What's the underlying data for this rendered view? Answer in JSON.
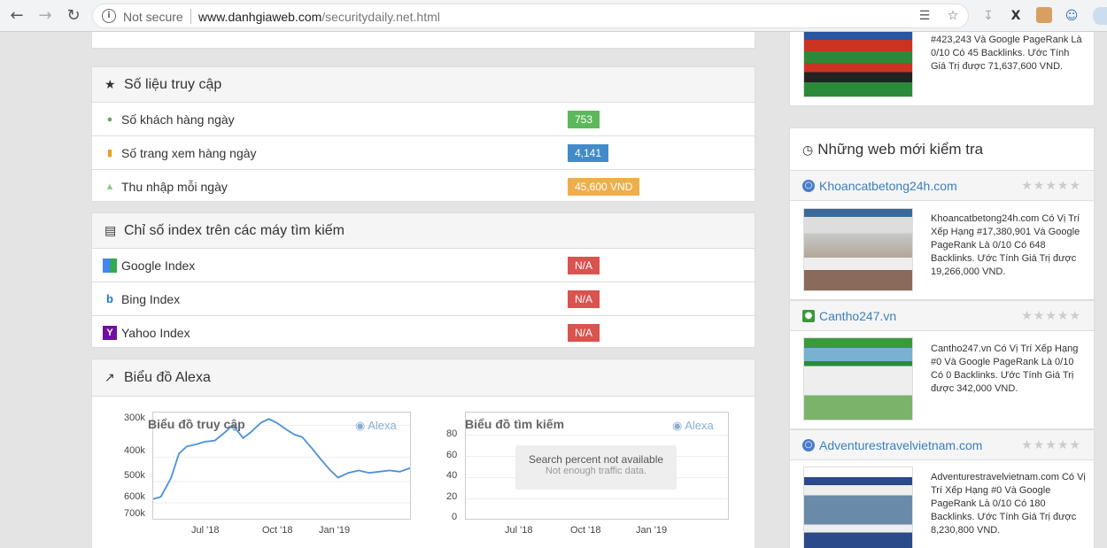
{
  "browser": {
    "security_label": "Not secure",
    "url_host": "www.danhgiaweb.com",
    "url_path": "/securitydaily.net.html"
  },
  "stats": {
    "title": "Số liệu truy cập",
    "rows": [
      {
        "label": "Số khách hàng ngày",
        "value": "753",
        "color": "#5cb85c"
      },
      {
        "label": "Số trang xem hàng ngày",
        "value": "4,141",
        "color": "#428bca"
      },
      {
        "label": "Thu nhập mỗi ngày",
        "value": "45,600 VND",
        "color": "#f0ad4e"
      }
    ]
  },
  "index": {
    "title": "Chỉ số index trên các máy tìm kiếm",
    "rows": [
      {
        "label": "Google Index",
        "value": "N/A"
      },
      {
        "label": "Bing Index",
        "value": "N/A"
      },
      {
        "label": "Yahoo Index",
        "value": "N/A"
      }
    ],
    "na_color": "#d9534f"
  },
  "alexa": {
    "title": "Biểu đồ Alexa",
    "brand": "Alexa",
    "search_msg": "Search percent not available",
    "search_sub": "Not enough traffic data."
  },
  "chart_data": [
    {
      "type": "line",
      "title": "Biểu đồ truy cập",
      "y_ticks": [
        "300k",
        "400k",
        "500k",
        "600k",
        "700k"
      ],
      "x_ticks": [
        "Jul '18",
        "Oct '18",
        "Jan '19"
      ],
      "y_inverted": true,
      "ylim": [
        300000,
        700000
      ],
      "x": [
        0,
        0.03,
        0.07,
        0.1,
        0.13,
        0.17,
        0.2,
        0.24,
        0.28,
        0.31,
        0.35,
        0.38,
        0.42,
        0.45,
        0.48,
        0.52,
        0.55,
        0.58,
        0.62,
        0.65,
        0.69,
        0.72,
        0.76,
        0.8,
        0.84,
        0.88,
        0.92,
        0.96,
        1.0
      ],
      "values": [
        640000,
        630000,
        550000,
        450000,
        420000,
        410000,
        400000,
        395000,
        360000,
        330000,
        385000,
        360000,
        320000,
        305000,
        320000,
        350000,
        370000,
        380000,
        430000,
        470000,
        520000,
        550000,
        530000,
        520000,
        530000,
        525000,
        520000,
        525000,
        510000
      ]
    },
    {
      "type": "line",
      "title": "Biểu đồ tìm kiếm",
      "y_ticks": [
        "80",
        "60",
        "40",
        "20",
        "0"
      ],
      "x_ticks": [
        "Jul '18",
        "Oct '18",
        "Jan '19"
      ],
      "ylim": [
        0,
        80
      ],
      "series": []
    }
  ],
  "new_sites": {
    "title": "Những web mới kiểm tra",
    "top_desc": "#423,243 Và Google PageRank Là 0/10 Có 45 Backlinks. Ước Tính Giá Trị được 71,637,600 VND.",
    "items": [
      {
        "name": "Khoancatbetong24h.com",
        "desc": "Khoancatbetong24h.com Có Vị Trí Xếp Hạng #17,380,901 Và Google PageRank Là 0/10 Có 648 Backlinks. Ước Tính Giá Trị được 19,266,000 VND."
      },
      {
        "name": "Cantho247.vn",
        "desc": "Cantho247.vn Có Vị Trí Xếp Hạng #0 Và Google PageRank Là 0/10 Có 0 Backlinks. Ước Tính Giá Trị được 342,000 VND."
      },
      {
        "name": "Adventurestravelvietnam.com",
        "desc": "Adventurestravelvietnam.com Có Vị Trí Xếp Hạng #0 Và Google PageRank Là 0/10 Có 180 Backlinks. Ước Tính Giá Trị được 8,230,800 VND."
      }
    ]
  }
}
